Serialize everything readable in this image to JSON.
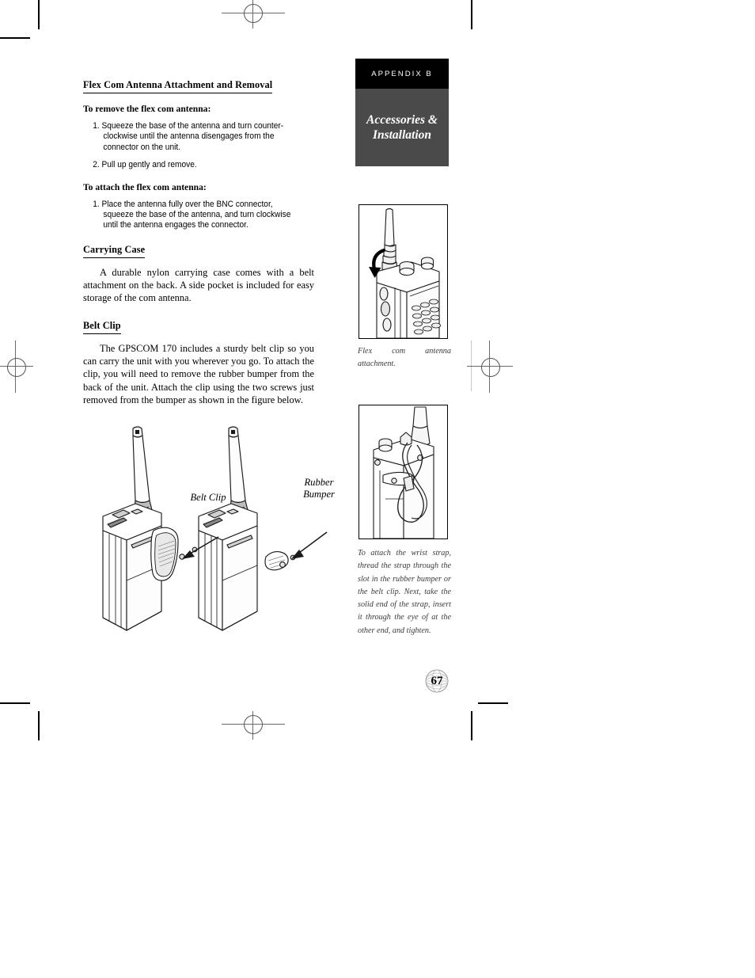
{
  "document": {
    "page_number": "67",
    "appendix_tab": "APPENDIX B",
    "appendix_title_line1": "Accessories &",
    "appendix_title_line2": "Installation"
  },
  "left_column": {
    "section_heading": "Flex Com Antenna Attachment and Removal",
    "subheading_remove": "To remove the flex com antenna:",
    "remove_steps": [
      "1. Squeeze the base of the antenna and turn counter-clockwise until the antenna disengages from the connector on the unit.",
      "2. Pull up gently and remove."
    ],
    "subheading_attach": "To attach the flex com antenna:",
    "attach_steps": [
      "1. Place the antenna fully over the BNC connector, squeeze the base of the antenna, and turn clockwise until the antenna engages the connector."
    ],
    "carrying_case_heading": "Carrying Case",
    "carrying_case_body": "A durable nylon carrying case comes with a belt attachment on the back. A side pocket is included for easy storage of the com antenna.",
    "belt_clip_heading": "Belt Clip",
    "belt_clip_body": "The GPSCOM 170 includes a sturdy belt clip so you can carry the unit with you wherever you go. To attach the clip, you will need to remove the rubber bumper from the back of the unit. Attach the clip using the two screws just removed from the bumper as shown in the figure below."
  },
  "figures": {
    "fig1_caption": "Flex com antenna attachment.",
    "fig2_caption": "To attach the wrist strap, thread the strap through the slot in the rubber bumper or the belt clip. Next, take the solid end of the strap, insert it through the eye of at the other end, and tighten.",
    "bottom_figure_labels": {
      "belt_clip": "Belt Clip",
      "rubber_bumper_line1": "Rubber",
      "rubber_bumper_line2": "Bumper"
    }
  },
  "colors": {
    "appendix_bar_bg": "#000000",
    "appendix_title_bg": "#4a4a4a",
    "text": "#000000",
    "caption_text": "#3b3b3b"
  }
}
